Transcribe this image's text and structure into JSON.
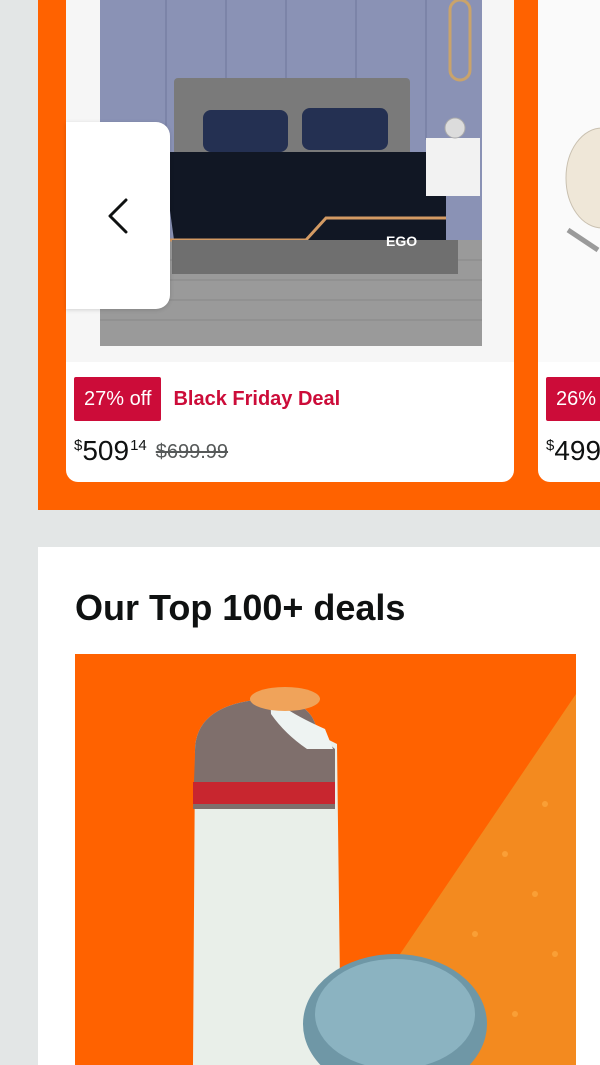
{
  "carousel": {
    "prev_icon": "chevron-left-icon",
    "main_card": {
      "image_label": "EGO",
      "discount_badge": "27% off",
      "deal_label": "Black Friday Deal",
      "price": {
        "symbol": "$",
        "whole": "509",
        "fraction": "14"
      },
      "list_price": "$699.99"
    },
    "peek_card": {
      "discount_badge": "26%",
      "price": {
        "symbol": "$",
        "whole": "499"
      }
    }
  },
  "top_deals": {
    "title": "Our Top 100+ deals"
  },
  "colors": {
    "brand_orange": "#ff6200",
    "deal_red": "#cc0c39",
    "page_bg": "#e3e6e6"
  }
}
